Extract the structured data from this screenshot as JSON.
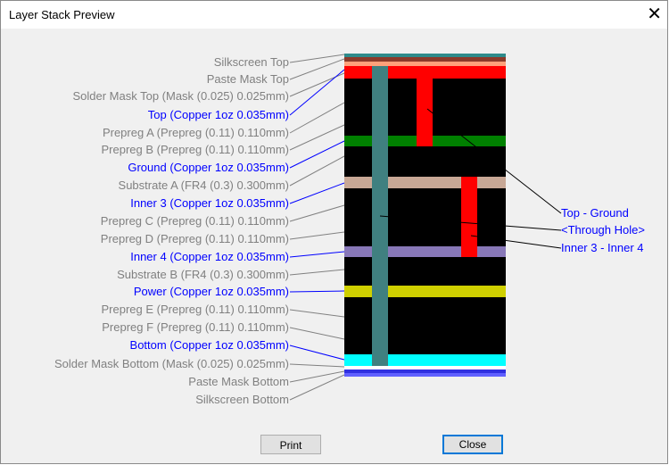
{
  "window": {
    "title": "Layer Stack Preview",
    "close_glyph": "✕"
  },
  "layers": [
    {
      "label": "Silkscreen Top",
      "kind": "overlay"
    },
    {
      "label": "Paste Mask Top",
      "kind": "overlay"
    },
    {
      "label": "Solder Mask Top (Mask (0.025) 0.025mm)",
      "kind": "overlay"
    },
    {
      "label": "Top (Copper 1oz 0.035mm)",
      "kind": "copper"
    },
    {
      "label": "Prepreg A (Prepreg (0.11) 0.110mm)",
      "kind": "dielectric"
    },
    {
      "label": "Prepreg B (Prepreg (0.11) 0.110mm)",
      "kind": "dielectric"
    },
    {
      "label": "Ground (Copper 1oz 0.035mm)",
      "kind": "copper"
    },
    {
      "label": "Substrate A (FR4 (0.3) 0.300mm)",
      "kind": "dielectric"
    },
    {
      "label": "Inner 3 (Copper 1oz 0.035mm)",
      "kind": "copper"
    },
    {
      "label": "Prepreg C (Prepreg (0.11) 0.110mm)",
      "kind": "dielectric"
    },
    {
      "label": "Prepreg D (Prepreg (0.11) 0.110mm)",
      "kind": "dielectric"
    },
    {
      "label": "Inner 4 (Copper 1oz 0.035mm)",
      "kind": "copper"
    },
    {
      "label": "Substrate B (FR4 (0.3) 0.300mm)",
      "kind": "dielectric"
    },
    {
      "label": "Power (Copper 1oz 0.035mm)",
      "kind": "copper"
    },
    {
      "label": "Prepreg E (Prepreg (0.11) 0.110mm)",
      "kind": "dielectric"
    },
    {
      "label": "Prepreg F (Prepreg (0.11) 0.110mm)",
      "kind": "dielectric"
    },
    {
      "label": "Bottom (Copper 1oz 0.035mm)",
      "kind": "copper"
    },
    {
      "label": "Solder Mask Bottom (Mask (0.025) 0.025mm)",
      "kind": "overlay"
    },
    {
      "label": "Paste Mask Bottom",
      "kind": "overlay"
    },
    {
      "label": "Silkscreen Bottom",
      "kind": "overlay"
    }
  ],
  "vias": [
    {
      "label": "Top - Ground"
    },
    {
      "label": "<Through Hole>"
    },
    {
      "label": "Inner 3 - Inner 4"
    }
  ],
  "colors": {
    "silkscreen_top": "#2e8b8b",
    "paste_mask_top": "#8b3a2a",
    "solder_mask_top": "#ffa07a",
    "top_copper": "#ff0000",
    "dielectric": "#000000",
    "ground_copper": "#008000",
    "substrate_a": "#c8a896",
    "inner4_copper": "#8878b8",
    "power_copper": "#d0d000",
    "bottom_copper": "#00ffff",
    "paste_mask_bottom": "#3030e0",
    "silkscreen_bottom": "#6060ff",
    "through_hole": "#408080",
    "blind_via": "#ff0000",
    "label_dielectric": "#808080",
    "label_copper": "#0000ff"
  },
  "buttons": {
    "print": "Print",
    "close": "Close"
  }
}
